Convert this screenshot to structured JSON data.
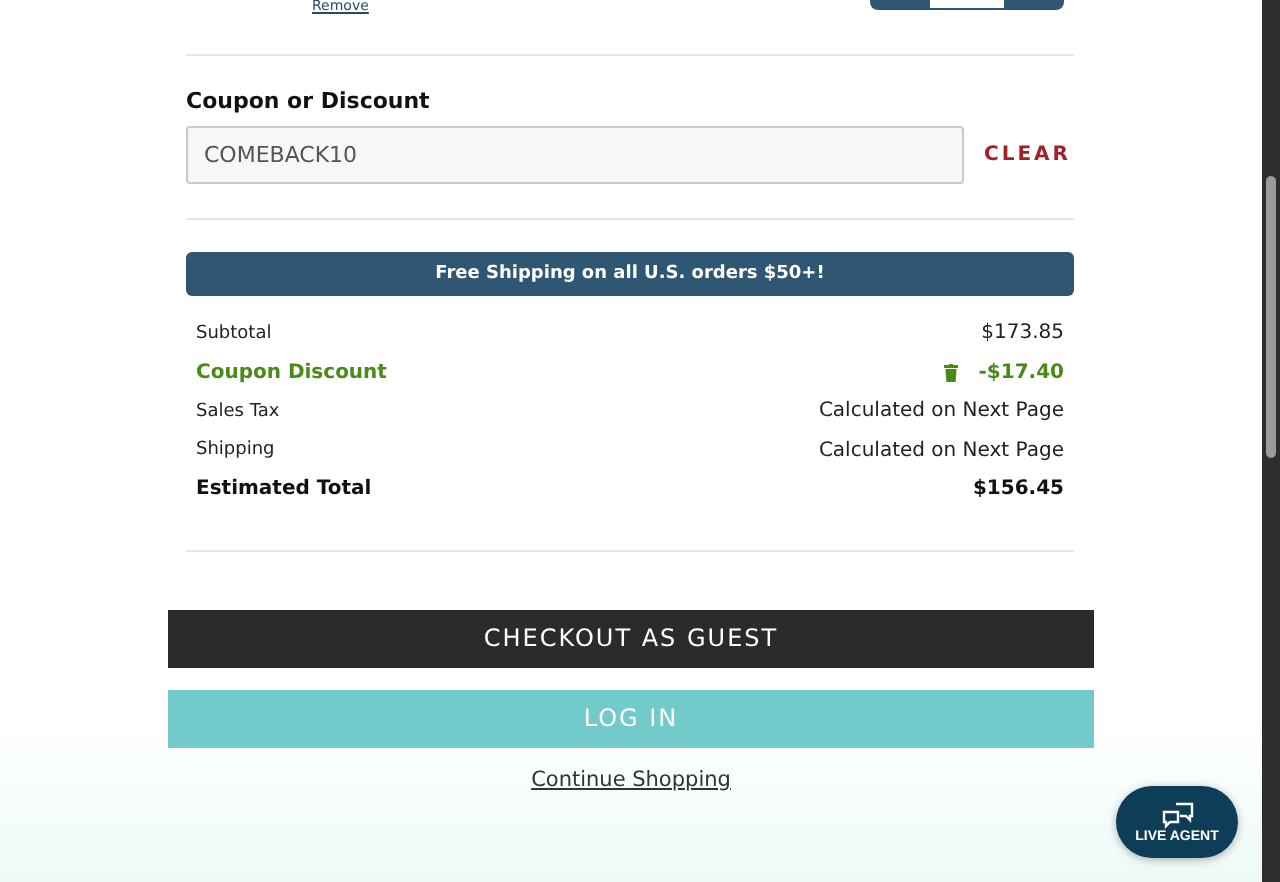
{
  "cart_item": {
    "remove_link": "Remove"
  },
  "coupon": {
    "label": "Coupon or Discount",
    "value": "COMEBACK10",
    "clear_button": "CLEAR"
  },
  "banner": "Free Shipping on all U.S. orders $50+!",
  "summary": [
    {
      "kind": "plain",
      "label": "Subtotal",
      "value": "$173.85"
    },
    {
      "kind": "discount",
      "label": "Coupon Discount",
      "value": "-$17.40"
    },
    {
      "kind": "plain",
      "label": "Sales Tax",
      "value": "Calculated on Next Page"
    },
    {
      "kind": "plain",
      "label": "Shipping",
      "value": "Calculated on Next Page"
    },
    {
      "kind": "total",
      "label": "Estimated Total",
      "value": "$156.45"
    }
  ],
  "buttons": {
    "checkout": "CHECKOUT AS GUEST",
    "login": "LOG IN",
    "continue": "Continue Shopping"
  },
  "chat": {
    "label": "LIVE AGENT"
  }
}
